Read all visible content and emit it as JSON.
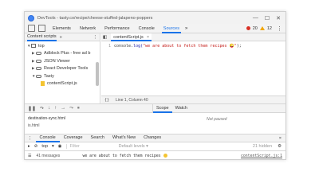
{
  "window": {
    "title": "DevTools - tasty.co/recipe/cheese-stuffed-jalapeno-poppers",
    "controls": [
      "—",
      "☐",
      "✕"
    ]
  },
  "devtools_tabs": [
    "Elements",
    "Network",
    "Performance",
    "Console",
    "Sources"
  ],
  "active_tab": "Sources",
  "counters": {
    "errors": "20",
    "warnings": "12"
  },
  "navigator": {
    "tab_label": "Content scripts",
    "more": "»",
    "tree": [
      {
        "label": "top",
        "expanded": true,
        "depth": 0
      },
      {
        "label": "Adblock Plus - free ad b",
        "expanded": false,
        "depth": 1
      },
      {
        "label": "JSON Viewer",
        "expanded": false,
        "depth": 1
      },
      {
        "label": "React Developer Tools",
        "expanded": false,
        "depth": 1
      },
      {
        "label": "Tasty",
        "expanded": true,
        "depth": 1
      },
      {
        "label": "contentScript.js",
        "depth": 2
      }
    ]
  },
  "editor": {
    "file_tab": "contentScript.js",
    "line_number": "1",
    "code_prefix": "console.",
    "code_method": "log(",
    "code_string": "\"we are about to fetch them recipes 😜\"",
    "code_suffix": ");",
    "status": "Line 1, Column 40"
  },
  "debugger": {
    "scope_tab": "Scope",
    "watch_tab": "Watch",
    "row1": "destination-sync.html",
    "row2": "is.html",
    "not_paused": "Not paused"
  },
  "drawer": {
    "tabs": [
      "Console",
      "Coverage",
      "Search",
      "What's New",
      "Changes"
    ],
    "active": "Console",
    "context": "top",
    "filter_placeholder": "Filter",
    "levels": "Default levels ▾",
    "hidden": "21 hidden",
    "message_count": "41 messages",
    "message_text": "we are about to fetch them recipes",
    "message_source": "contentScript.js:1"
  }
}
